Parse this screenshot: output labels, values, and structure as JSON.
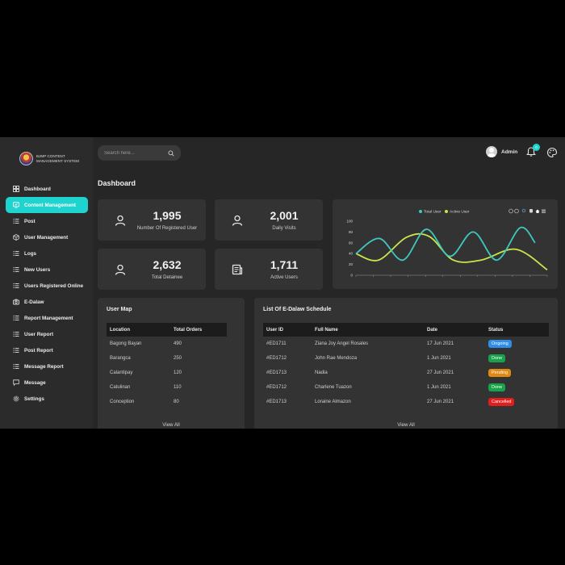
{
  "brand": {
    "name": "BJMP CONTENT MANAGEMENT SYSTEM"
  },
  "sidebar": {
    "items": [
      {
        "label": "Dashboard",
        "icon": "grid-icon",
        "active": false
      },
      {
        "label": "Content Management",
        "icon": "monitor-icon",
        "active": true
      },
      {
        "label": "Post",
        "icon": "list-icon",
        "active": false
      },
      {
        "label": "User Management",
        "icon": "cube-icon",
        "active": false
      },
      {
        "label": "Logs",
        "icon": "list-icon",
        "active": false
      },
      {
        "label": "New Users",
        "icon": "list-icon",
        "active": false
      },
      {
        "label": "Users Registered Online",
        "icon": "list-icon",
        "active": false
      },
      {
        "label": "E-Dalaw",
        "icon": "camera-icon",
        "active": false
      },
      {
        "label": "Report Management",
        "icon": "list-icon",
        "active": false
      },
      {
        "label": "User Report",
        "icon": "list-icon",
        "active": false
      },
      {
        "label": "Post Report",
        "icon": "list-icon",
        "active": false
      },
      {
        "label": "Message Report",
        "icon": "list-icon",
        "active": false
      },
      {
        "label": "Message",
        "icon": "message-icon",
        "active": false
      },
      {
        "label": "Settings",
        "icon": "gear-icon",
        "active": false
      }
    ]
  },
  "topbar": {
    "search_placeholder": "Search here...",
    "user_name": "Admin",
    "notification_count": "0"
  },
  "page": {
    "title": "Dashboard"
  },
  "stats": [
    {
      "value": "1,995",
      "label": "Number Of Registered User",
      "icon": "user-icon"
    },
    {
      "value": "2,001",
      "label": "Daily Visits",
      "icon": "user-icon"
    },
    {
      "value": "2,632",
      "label": "Total Detainee",
      "icon": "user-icon"
    },
    {
      "value": "1,711",
      "label": "Active Users",
      "icon": "newspaper-icon"
    }
  ],
  "chart_data": {
    "type": "line",
    "smooth": true,
    "x": [
      0,
      1,
      2,
      3,
      4,
      5,
      6,
      7,
      8,
      9,
      10,
      11
    ],
    "ylim": [
      0,
      100
    ],
    "yticks": [
      0,
      20,
      40,
      60,
      80,
      100
    ],
    "grid": false,
    "legend_position": "top-center",
    "series": [
      {
        "name": "Total User",
        "color": "#3ec9c0",
        "values": [
          40,
          68,
          28,
          85,
          35,
          80,
          28,
          88,
          60
        ]
      },
      {
        "name": "Active User",
        "color": "#c8e64a",
        "values": [
          40,
          28,
          70,
          72,
          28,
          28,
          48,
          10
        ]
      }
    ],
    "toolbar_icons": [
      "zoom-in-icon",
      "zoom-out-icon",
      "magnifier-icon",
      "hand-icon",
      "home-icon",
      "menu-icon"
    ]
  },
  "user_map": {
    "title": "User Map",
    "columns": [
      "Location",
      "Total Orders"
    ],
    "rows": [
      [
        "Bagong Bayan",
        "490"
      ],
      [
        "Barangca",
        "250"
      ],
      [
        "Calantipay",
        "120"
      ],
      [
        "Catulinan",
        "110"
      ],
      [
        "Conception",
        "80"
      ]
    ],
    "view_all": "View All"
  },
  "schedule": {
    "title": "List Of E-Dalaw Schedule",
    "columns": [
      "User ID",
      "Full Name",
      "Date",
      "Status"
    ],
    "rows": [
      {
        "id": "#ED1711",
        "name": "Ziana Joy Angel Rosales",
        "date": "17 Jun 2021",
        "status": "Ongoing",
        "status_color": "#2f8ee8"
      },
      {
        "id": "#ED1712",
        "name": "John Rae Mendoza",
        "date": "1 Jun 2021",
        "status": "Done",
        "status_color": "#16a34a"
      },
      {
        "id": "#ED1713",
        "name": "Nadia",
        "date": "27 Jun 2021",
        "status": "Pending",
        "status_color": "#e08a14"
      },
      {
        "id": "#ED1712",
        "name": "Charlene Tuazon",
        "date": "1 Jun 2021",
        "status": "Done",
        "status_color": "#16a34a"
      },
      {
        "id": "#ED1713",
        "name": "Loraine Almazon",
        "date": "27 Jun 2021",
        "status": "Cancelled",
        "status_color": "#e11d1d"
      }
    ],
    "view_all": "View All"
  },
  "colors": {
    "accent": "#1fd4cf",
    "card": "#333333",
    "background": "#262626",
    "sidebar": "#2b2b2b"
  }
}
